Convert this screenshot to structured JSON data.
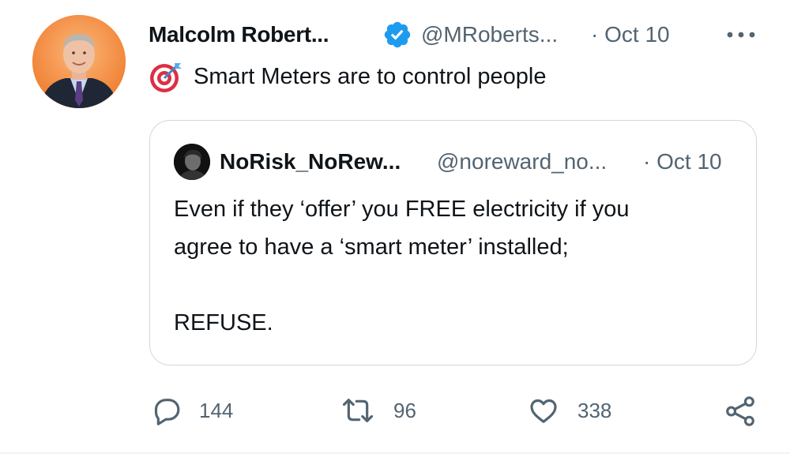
{
  "tweet": {
    "author_name": "Malcolm Robert...",
    "author_handle": "@MRoberts...",
    "date": "· Oct 10",
    "text": "Smart Meters are to control people",
    "emoji_icon": "direct-hit-target-icon",
    "verified_icon": "verified-badge-icon",
    "more_icon": "more-options-icon"
  },
  "quote": {
    "author_name": "NoRisk_NoRew...",
    "author_handle": "@noreward_no...",
    "date": "· Oct 10",
    "lines": [
      "Even if they ‘offer’ you FREE electricity if you",
      "agree to have a ‘smart meter’ installed;",
      "",
      "REFUSE."
    ]
  },
  "actions": {
    "reply_count": "144",
    "retweet_count": "96",
    "like_count": "338"
  },
  "colors": {
    "verified_blue": "#1d9bf0",
    "secondary_text": "#536471",
    "border": "#cfd9de"
  }
}
